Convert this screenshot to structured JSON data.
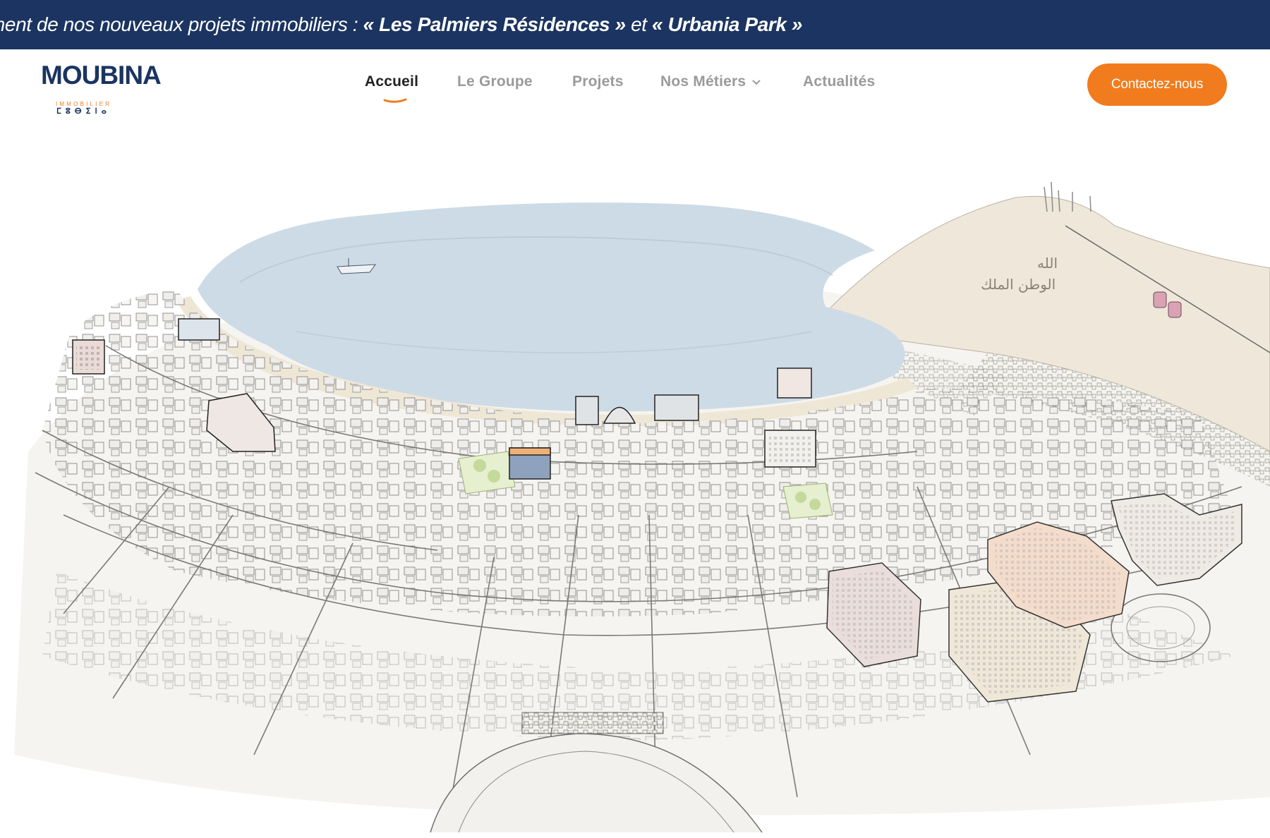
{
  "ticker": {
    "prefix": "ment de nos nouveaux projets immobiliers : ",
    "project1": "« Les Palmiers Résidences »",
    "conj": " et ",
    "project2": "« Urbania Park »"
  },
  "logo": {
    "name": "MOUBINA",
    "subtitle": "IMMOBILIER",
    "tifinagh": "ⵎⵓⴱⵉⵏⴰ"
  },
  "nav": {
    "items": [
      {
        "label": "Accueil",
        "active": true
      },
      {
        "label": "Le Groupe",
        "active": false
      },
      {
        "label": "Projets",
        "active": false
      },
      {
        "label": "Nos Métiers",
        "active": false,
        "dropdown": true
      },
      {
        "label": "Actualités",
        "active": false
      }
    ]
  },
  "cta": {
    "label": "Contactez-nous"
  },
  "map": {
    "mountain_text_1": "الله",
    "mountain_text_2": "الوطن الملك"
  },
  "colors": {
    "ticker_bg": "#1b3461",
    "brand_blue": "#1b3461",
    "accent_orange": "#f07c1e",
    "sea": "#cddbe6"
  }
}
